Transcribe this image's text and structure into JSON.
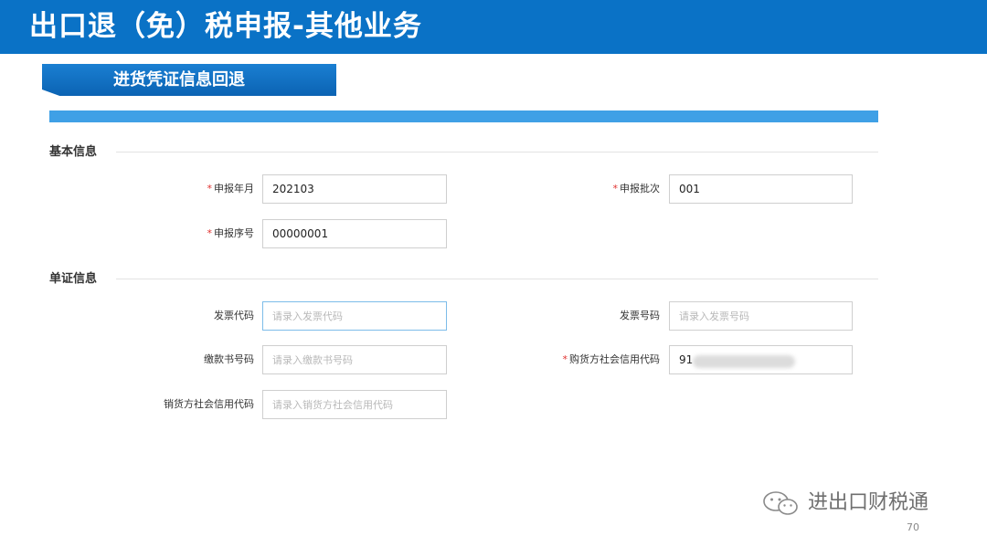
{
  "banner": {
    "title": "出口退（免）税申报-其他业务"
  },
  "section": {
    "tab_label": "进货凭证信息回退"
  },
  "basic_info": {
    "title": "基本信息",
    "declare_month": {
      "label": "申报年月",
      "value": "202103",
      "required": true
    },
    "declare_batch": {
      "label": "申报批次",
      "value": "001",
      "required": true
    },
    "declare_seq": {
      "label": "申报序号",
      "value": "00000001",
      "required": true
    }
  },
  "voucher_info": {
    "title": "单证信息",
    "invoice_code": {
      "label": "发票代码",
      "placeholder": "请录入发票代码"
    },
    "invoice_number": {
      "label": "发票号码",
      "placeholder": "请录入发票号码"
    },
    "payment_number": {
      "label": "缴款书号码",
      "placeholder": "请录入缴款书号码"
    },
    "buyer_credit_code": {
      "label": "购货方社会信用代码",
      "value": "91",
      "required": true
    },
    "seller_credit_code": {
      "label": "销货方社会信用代码",
      "placeholder": "请录入销货方社会信用代码"
    }
  },
  "required_mark": "*",
  "watermark": {
    "text": "进出口财税通",
    "icon": "wechat-icon"
  },
  "page_number": "70",
  "colors": {
    "banner": "#0a72c6",
    "accent_bar": "#3fa0e6",
    "required": "#e0312e"
  }
}
